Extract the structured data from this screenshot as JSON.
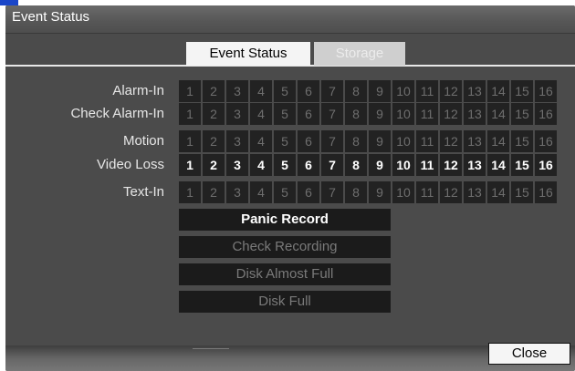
{
  "window": {
    "title": "Event Status"
  },
  "tabs": [
    {
      "label": "Event Status",
      "active": true
    },
    {
      "label": "Storage",
      "active": false
    }
  ],
  "rows": [
    {
      "label": "Alarm-In",
      "highlighted": false
    },
    {
      "label": "Check Alarm-In",
      "highlighted": false
    },
    {
      "label": "Motion",
      "highlighted": false
    },
    {
      "label": "Video Loss",
      "highlighted": true
    },
    {
      "label": "Text-In",
      "highlighted": false
    }
  ],
  "channels": [
    "1",
    "2",
    "3",
    "4",
    "5",
    "6",
    "7",
    "8",
    "9",
    "10",
    "11",
    "12",
    "13",
    "14",
    "15",
    "16"
  ],
  "status_buttons": [
    {
      "label": "Panic Record",
      "active": true
    },
    {
      "label": "Check Recording",
      "active": false
    },
    {
      "label": "Disk Almost Full",
      "active": false
    },
    {
      "label": "Disk Full",
      "active": false
    }
  ],
  "close_label": "Close"
}
